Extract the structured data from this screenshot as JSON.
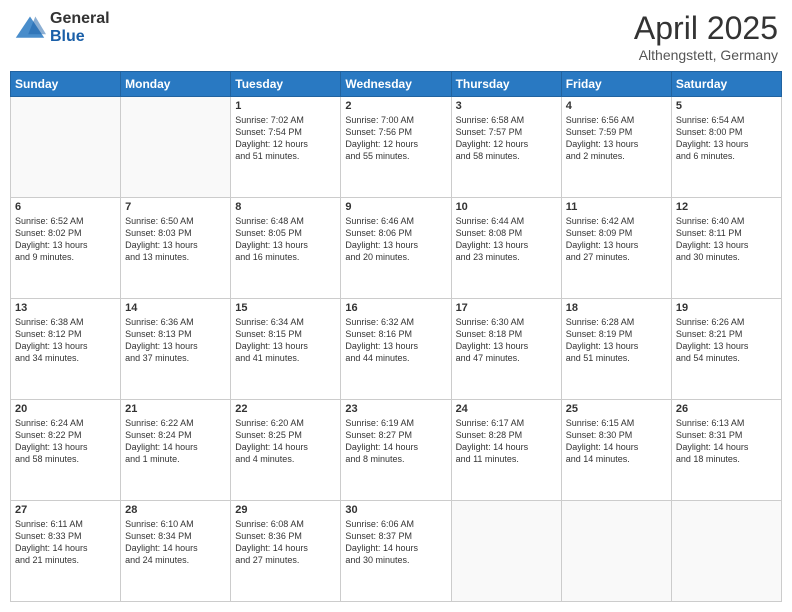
{
  "logo": {
    "general": "General",
    "blue": "Blue"
  },
  "title": {
    "month_year": "April 2025",
    "location": "Althengstett, Germany"
  },
  "weekdays": [
    "Sunday",
    "Monday",
    "Tuesday",
    "Wednesday",
    "Thursday",
    "Friday",
    "Saturday"
  ],
  "weeks": [
    [
      {
        "day": "",
        "text": ""
      },
      {
        "day": "",
        "text": ""
      },
      {
        "day": "1",
        "text": "Sunrise: 7:02 AM\nSunset: 7:54 PM\nDaylight: 12 hours\nand 51 minutes."
      },
      {
        "day": "2",
        "text": "Sunrise: 7:00 AM\nSunset: 7:56 PM\nDaylight: 12 hours\nand 55 minutes."
      },
      {
        "day": "3",
        "text": "Sunrise: 6:58 AM\nSunset: 7:57 PM\nDaylight: 12 hours\nand 58 minutes."
      },
      {
        "day": "4",
        "text": "Sunrise: 6:56 AM\nSunset: 7:59 PM\nDaylight: 13 hours\nand 2 minutes."
      },
      {
        "day": "5",
        "text": "Sunrise: 6:54 AM\nSunset: 8:00 PM\nDaylight: 13 hours\nand 6 minutes."
      }
    ],
    [
      {
        "day": "6",
        "text": "Sunrise: 6:52 AM\nSunset: 8:02 PM\nDaylight: 13 hours\nand 9 minutes."
      },
      {
        "day": "7",
        "text": "Sunrise: 6:50 AM\nSunset: 8:03 PM\nDaylight: 13 hours\nand 13 minutes."
      },
      {
        "day": "8",
        "text": "Sunrise: 6:48 AM\nSunset: 8:05 PM\nDaylight: 13 hours\nand 16 minutes."
      },
      {
        "day": "9",
        "text": "Sunrise: 6:46 AM\nSunset: 8:06 PM\nDaylight: 13 hours\nand 20 minutes."
      },
      {
        "day": "10",
        "text": "Sunrise: 6:44 AM\nSunset: 8:08 PM\nDaylight: 13 hours\nand 23 minutes."
      },
      {
        "day": "11",
        "text": "Sunrise: 6:42 AM\nSunset: 8:09 PM\nDaylight: 13 hours\nand 27 minutes."
      },
      {
        "day": "12",
        "text": "Sunrise: 6:40 AM\nSunset: 8:11 PM\nDaylight: 13 hours\nand 30 minutes."
      }
    ],
    [
      {
        "day": "13",
        "text": "Sunrise: 6:38 AM\nSunset: 8:12 PM\nDaylight: 13 hours\nand 34 minutes."
      },
      {
        "day": "14",
        "text": "Sunrise: 6:36 AM\nSunset: 8:13 PM\nDaylight: 13 hours\nand 37 minutes."
      },
      {
        "day": "15",
        "text": "Sunrise: 6:34 AM\nSunset: 8:15 PM\nDaylight: 13 hours\nand 41 minutes."
      },
      {
        "day": "16",
        "text": "Sunrise: 6:32 AM\nSunset: 8:16 PM\nDaylight: 13 hours\nand 44 minutes."
      },
      {
        "day": "17",
        "text": "Sunrise: 6:30 AM\nSunset: 8:18 PM\nDaylight: 13 hours\nand 47 minutes."
      },
      {
        "day": "18",
        "text": "Sunrise: 6:28 AM\nSunset: 8:19 PM\nDaylight: 13 hours\nand 51 minutes."
      },
      {
        "day": "19",
        "text": "Sunrise: 6:26 AM\nSunset: 8:21 PM\nDaylight: 13 hours\nand 54 minutes."
      }
    ],
    [
      {
        "day": "20",
        "text": "Sunrise: 6:24 AM\nSunset: 8:22 PM\nDaylight: 13 hours\nand 58 minutes."
      },
      {
        "day": "21",
        "text": "Sunrise: 6:22 AM\nSunset: 8:24 PM\nDaylight: 14 hours\nand 1 minute."
      },
      {
        "day": "22",
        "text": "Sunrise: 6:20 AM\nSunset: 8:25 PM\nDaylight: 14 hours\nand 4 minutes."
      },
      {
        "day": "23",
        "text": "Sunrise: 6:19 AM\nSunset: 8:27 PM\nDaylight: 14 hours\nand 8 minutes."
      },
      {
        "day": "24",
        "text": "Sunrise: 6:17 AM\nSunset: 8:28 PM\nDaylight: 14 hours\nand 11 minutes."
      },
      {
        "day": "25",
        "text": "Sunrise: 6:15 AM\nSunset: 8:30 PM\nDaylight: 14 hours\nand 14 minutes."
      },
      {
        "day": "26",
        "text": "Sunrise: 6:13 AM\nSunset: 8:31 PM\nDaylight: 14 hours\nand 18 minutes."
      }
    ],
    [
      {
        "day": "27",
        "text": "Sunrise: 6:11 AM\nSunset: 8:33 PM\nDaylight: 14 hours\nand 21 minutes."
      },
      {
        "day": "28",
        "text": "Sunrise: 6:10 AM\nSunset: 8:34 PM\nDaylight: 14 hours\nand 24 minutes."
      },
      {
        "day": "29",
        "text": "Sunrise: 6:08 AM\nSunset: 8:36 PM\nDaylight: 14 hours\nand 27 minutes."
      },
      {
        "day": "30",
        "text": "Sunrise: 6:06 AM\nSunset: 8:37 PM\nDaylight: 14 hours\nand 30 minutes."
      },
      {
        "day": "",
        "text": ""
      },
      {
        "day": "",
        "text": ""
      },
      {
        "day": "",
        "text": ""
      }
    ]
  ]
}
